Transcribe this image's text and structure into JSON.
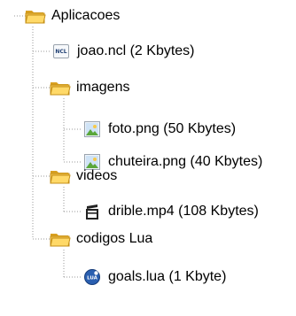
{
  "tree": {
    "root": {
      "label": "Aplicacoes",
      "icon": "folder-open-icon"
    },
    "items": [
      {
        "label": "joao.ncl (2 Kbytes)",
        "icon": "ncl-file-icon",
        "icon_text": "NCL"
      },
      {
        "label": "imagens",
        "icon": "folder-open-icon"
      },
      {
        "label": "foto.png (50 Kbytes)",
        "icon": "image-file-icon"
      },
      {
        "label": "chuteira.png (40 Kbytes)",
        "icon": "image-file-icon"
      },
      {
        "label": "videos",
        "icon": "folder-open-icon"
      },
      {
        "label": "drible.mp4 (108 Kbytes)",
        "icon": "video-file-icon"
      },
      {
        "label": "codigos Lua",
        "icon": "folder-open-icon"
      },
      {
        "label": "goals.lua (1 Kbyte)",
        "icon": "lua-file-icon",
        "icon_text": "LUA"
      }
    ]
  },
  "colors": {
    "connector": "#9a9a9a",
    "folder": "#f3c34a",
    "folder_dark": "#d9a020",
    "lua_badge": "#2a5fb0"
  }
}
